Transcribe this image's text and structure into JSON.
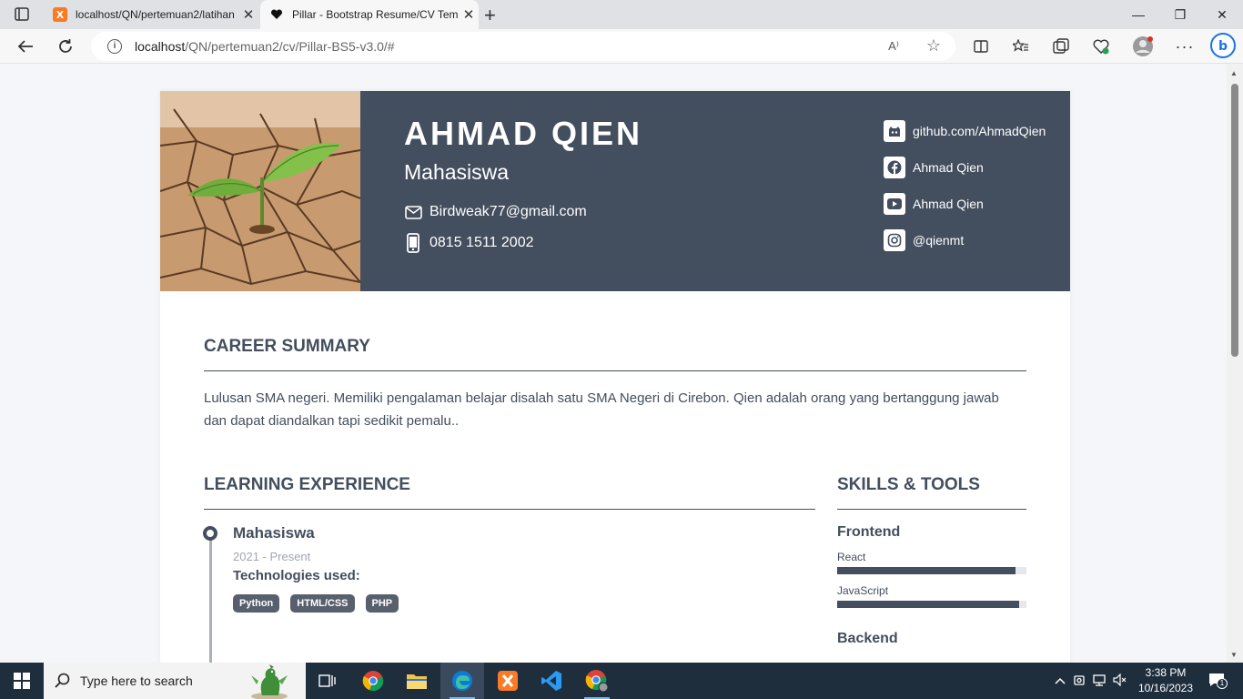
{
  "browser": {
    "tabs": [
      {
        "title": "localhost/QN/pertemuan2/latihan",
        "active": false
      },
      {
        "title": "Pillar - Bootstrap Resume/CV Template",
        "active": true
      }
    ],
    "url_host": "localhost",
    "url_path": "/QN/pertemuan2/cv/Pillar-BS5-v3.0/#",
    "read_aloud": "A⁾"
  },
  "resume": {
    "name": "AHMAD QIEN",
    "role": "Mahasiswa",
    "email": "Birdweak77@gmail.com",
    "phone": "0815 1511 2002",
    "social": [
      {
        "icon": "github-icon",
        "label": "github.com/AhmadQien"
      },
      {
        "icon": "facebook-icon",
        "label": "Ahmad Qien"
      },
      {
        "icon": "youtube-icon",
        "label": "Ahmad Qien"
      },
      {
        "icon": "instagram-icon",
        "label": "@qienmt"
      }
    ],
    "career_title": "CAREER SUMMARY",
    "career_text": "Lulusan SMA negeri. Memiliki pengalaman belajar disalah satu SMA Negeri di Cirebon. Qien adalah orang yang bertanggung jawab dan dapat diandalkan tapi sedikit pemalu..",
    "experience_title": "LEARNING EXPERIENCE",
    "experience": {
      "title": "Mahasiswa",
      "date": "2021 - Present",
      "tech_label": "Technologies used:",
      "tags": [
        "Python",
        "HTML/CSS",
        "PHP"
      ]
    },
    "skills_title": "SKILLS & TOOLS",
    "skills": {
      "frontend_label": "Frontend",
      "frontend": [
        {
          "name": "React",
          "level": 0.94
        },
        {
          "name": "JavaScript",
          "level": 0.96
        }
      ],
      "backend_label": "Backend"
    }
  },
  "taskbar": {
    "search_placeholder": "Type here to search",
    "time": "3:38 PM",
    "date": "10/16/2023",
    "notification_count": "1"
  },
  "colors": {
    "header_bg": "#434e5e",
    "accent": "#434e5e",
    "taskbar": "#1f2e3d"
  }
}
